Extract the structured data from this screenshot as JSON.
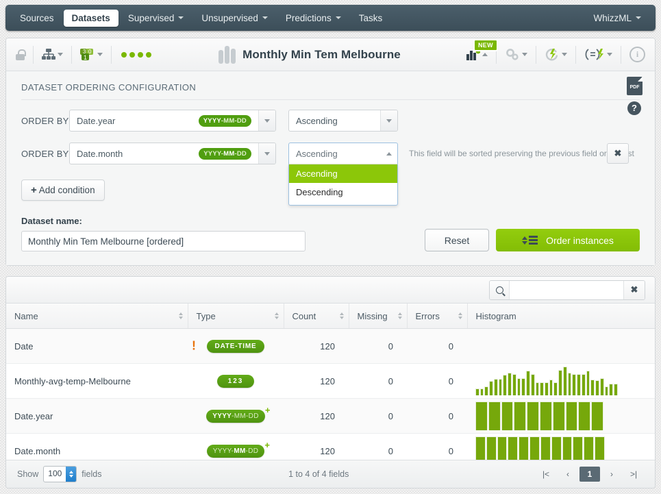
{
  "navbar": {
    "items": [
      {
        "label": "Sources",
        "active": false,
        "caret": false
      },
      {
        "label": "Datasets",
        "active": true,
        "caret": false
      },
      {
        "label": "Supervised",
        "active": false,
        "caret": true
      },
      {
        "label": "Unsupervised",
        "active": false,
        "caret": true
      },
      {
        "label": "Predictions",
        "active": false,
        "caret": true
      },
      {
        "label": "Tasks",
        "active": false,
        "caret": false
      }
    ],
    "right_label": "WhizzML"
  },
  "header": {
    "dataset_title": "Monthly Min Tem Melbourne",
    "new_badge": "NEW",
    "status_dots": 4
  },
  "config": {
    "section_title": "DATASET ORDERING CONFIGURATION",
    "pdf_label": "PDF",
    "help_label": "?",
    "rows": [
      {
        "order_by_label": "ORDER BY",
        "field_value": "Date.year",
        "badge_bold": "YYYY",
        "badge_rest": "-MM-DD",
        "direction": "Ascending",
        "open": false
      },
      {
        "order_by_label": "ORDER BY",
        "field_value": "Date.month",
        "badge_pre": "YYYY-",
        "badge_bold": "MM",
        "badge_post": "-DD",
        "direction": "Ascending",
        "open": true,
        "hint": "This field will be sorted preserving the previous field order first",
        "delete_label": "✖"
      }
    ],
    "direction_options": [
      "Ascending",
      "Descending"
    ],
    "add_condition_label": "Add condition",
    "dataset_name_label": "Dataset name:",
    "dataset_name_value": "Monthly Min Tem Melbourne [ordered]",
    "reset_label": "Reset",
    "order_instances_label": "Order instances",
    "accent_green": "#8cc709"
  },
  "fields_table": {
    "search_value": "",
    "search_clear_label": "✖",
    "columns": [
      "Name",
      "Type",
      "Count",
      "Missing",
      "Errors",
      "Histogram"
    ],
    "rows": [
      {
        "name": "Date",
        "type_badge": "DATE-TIME",
        "warn": "!",
        "count": "120",
        "missing": "0",
        "errors": "0",
        "histogram": []
      },
      {
        "name": "Monthly-avg-temp-Melbourne",
        "type_badge": "123",
        "count": "120",
        "missing": "0",
        "errors": "0",
        "histogram": [
          20,
          22,
          28,
          44,
          50,
          50,
          62,
          70,
          64,
          52,
          52,
          76,
          64,
          40,
          40,
          40,
          48,
          40,
          78,
          88,
          70,
          64,
          64,
          64,
          76,
          48,
          46,
          52,
          28,
          36,
          36
        ]
      },
      {
        "name": "Date.year",
        "type_badge_pre": "YYYY",
        "type_badge_post": "-MM-DD",
        "type_badge_plus": "+",
        "count": "120",
        "missing": "0",
        "errors": "0",
        "histogram": [
          100,
          100,
          100,
          100,
          100,
          100,
          100,
          100,
          100,
          100
        ]
      },
      {
        "name": "Date.month",
        "type_badge_pre": "YYYY-",
        "type_badge_mid": "MM",
        "type_badge_post": "-DD",
        "type_badge_plus": "+",
        "count": "120",
        "missing": "0",
        "errors": "0",
        "histogram": [
          100,
          100,
          100,
          100,
          100,
          100,
          100,
          100,
          100,
          100,
          100,
          100
        ]
      }
    ],
    "footer": {
      "show_label": "Show",
      "page_size": "100",
      "fields_label": "fields",
      "range_text": "1 to 4 of 4 fields",
      "pages": [
        "|<",
        "‹",
        "1",
        "›",
        ">|"
      ],
      "current_page": "1"
    }
  }
}
